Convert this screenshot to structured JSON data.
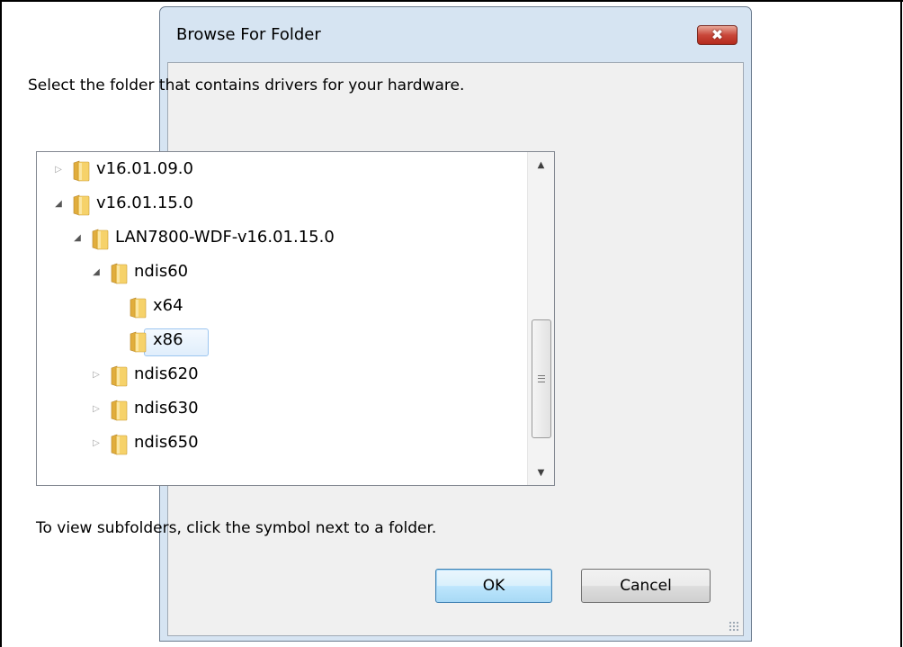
{
  "dialog": {
    "title": "Browse For Folder",
    "close_symbol": "✖",
    "instruction": "Select the folder that contains drivers for your hardware.",
    "hint": "To view subfolders, click the symbol next to a folder."
  },
  "tree": {
    "items": [
      {
        "label": "v16.01.09.0",
        "level": 0,
        "expander": "collapsed",
        "selected": false
      },
      {
        "label": "v16.01.15.0",
        "level": 0,
        "expander": "expanded",
        "selected": false
      },
      {
        "label": "LAN7800-WDF-v16.01.15.0",
        "level": 1,
        "expander": "expanded",
        "selected": false
      },
      {
        "label": "ndis60",
        "level": 2,
        "expander": "expanded",
        "selected": false
      },
      {
        "label": "x64",
        "level": 3,
        "expander": "none",
        "selected": false
      },
      {
        "label": "x86",
        "level": 3,
        "expander": "none",
        "selected": true
      },
      {
        "label": "ndis620",
        "level": 2,
        "expander": "collapsed",
        "selected": false
      },
      {
        "label": "ndis630",
        "level": 2,
        "expander": "collapsed",
        "selected": false
      },
      {
        "label": "ndis650",
        "level": 2,
        "expander": "collapsed",
        "selected": false
      }
    ],
    "icons": {
      "collapsed": "▷",
      "expanded": "◢",
      "up": "▲",
      "down": "▼",
      "folder": "folder-icon"
    }
  },
  "buttons": {
    "ok": "OK",
    "cancel": "Cancel"
  },
  "colors": {
    "dialog_frame": "#d6e4f2",
    "close_button": "#c9473a",
    "selection": "#e0eefc",
    "folder": "#f3c75a"
  }
}
